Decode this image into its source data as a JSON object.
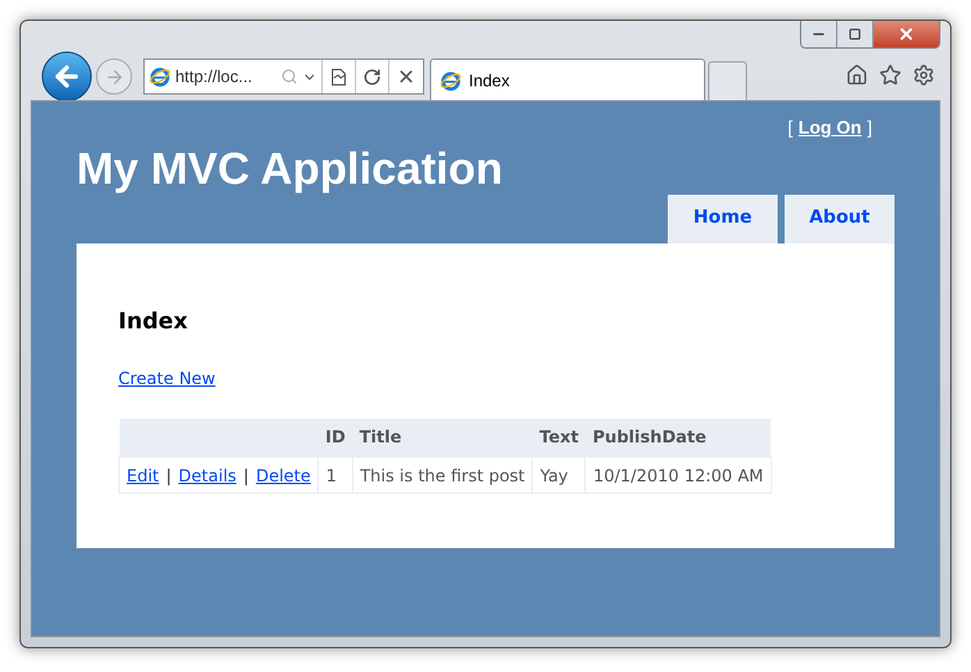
{
  "browser": {
    "address": "http://loc...",
    "tabs": [
      {
        "label": "Index",
        "selected": true
      }
    ]
  },
  "page": {
    "log_on": {
      "open": "[",
      "link": "Log On",
      "close": "]"
    },
    "title": "My MVC Application",
    "menu": [
      {
        "label": "Home"
      },
      {
        "label": "About"
      }
    ],
    "heading": "Index",
    "create_link": "Create New",
    "table": {
      "columns": [
        "ID",
        "Title",
        "Text",
        "PublishDate"
      ],
      "rows": [
        {
          "actions": [
            "Edit",
            "Details",
            "Delete"
          ],
          "separators": [
            "|",
            "|"
          ],
          "cells": [
            "1",
            "This is the first post",
            "Yay",
            "10/1/2010 12:00 AM"
          ]
        }
      ]
    }
  }
}
